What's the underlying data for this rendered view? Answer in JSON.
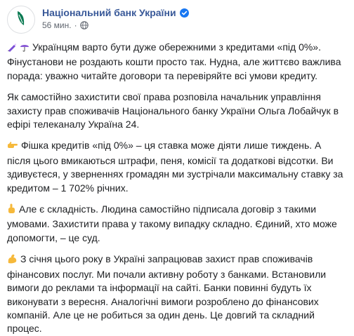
{
  "header": {
    "page_name": "Національний банк України",
    "time": "56 мин.",
    "separator": "·",
    "avatar_icon": "nbu-logo-icon",
    "verified_icon": "verified-badge-icon",
    "audience_icon": "globe-icon"
  },
  "colors": {
    "page_name": "#385898",
    "verified": "#1877f2",
    "logo": "#0b7a52",
    "meta_text": "#616770",
    "body_text": "#1c1e21"
  },
  "post": {
    "p1": {
      "emoji_icons": [
        "crayon-emoji-icon",
        "umbrella-emoji-icon"
      ],
      "text": "Українцям варто бути дуже обережними з кредитами «під 0%». Фінустанови не роздають кошти просто так. Нудна, але життєво важлива порада: уважно читайте договори та перевіряйте всі умови кредиту."
    },
    "p2": {
      "text": "Як самостійно захистити свої права розповіла начальник управління захисту прав споживачів Національного банку України Ольга Лобайчук в ефірі телеканалу Україна 24."
    },
    "p3": {
      "emoji_icon": "pointing-hand-emoji-icon",
      "text": "Фішка кредитів «під 0%» – ця ставка може діяти лише тиждень. А після цього вмикаються штрафи, пеня, комісії та додаткові відсотки. Ви здивуєтеся, у зверненнях громадян ми зустрічали максимальну ставку за кредитом – 1 702% річних."
    },
    "p4": {
      "emoji_icon": "index-up-emoji-icon",
      "text": "Але є складність. Людина самостійно підписала договір з такими умовами. Захистити права у такому випадку складно. Єдиний, хто може допомогти, – це суд."
    },
    "p5": {
      "emoji_icon": "flexed-biceps-emoji-icon",
      "text": "З січня цього року в Україні запрацював захист прав споживачів фінансових послуг. Ми почали активну роботу з банками. Встановили вимоги до реклами та інформації на сайті. Банки повинні будуть їх виконувати з вересня. Аналогічні вимоги розроблено до фінансових компаній. Але це не робиться за один день. Це довгий та складний процес."
    }
  }
}
